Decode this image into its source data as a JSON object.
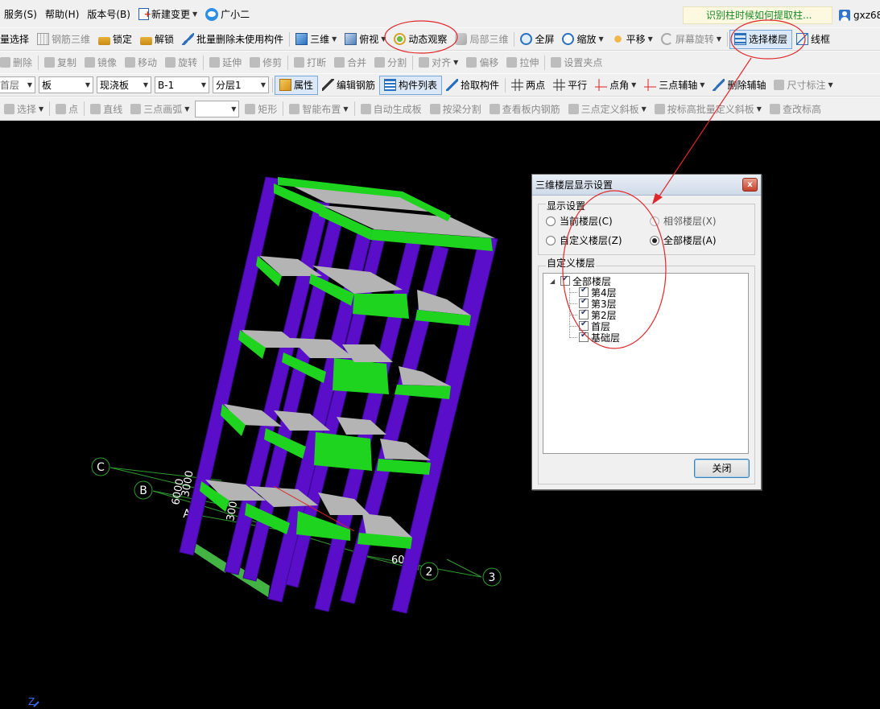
{
  "menubar": {
    "items": [
      {
        "label": "服务(S)"
      },
      {
        "label": "帮助(H)"
      },
      {
        "label": "版本号(B)"
      },
      {
        "label": "新建变更"
      },
      {
        "label": "广小二"
      }
    ],
    "hint": "识别柱时候如何提取柱...",
    "user": "gxz68"
  },
  "toolbar1": {
    "items": [
      "量选择",
      "钢筋三维",
      "锁定",
      "解锁",
      "批量删除未使用构件",
      "三维",
      "俯视",
      "动态观察",
      "局部三维",
      "全屏",
      "缩放",
      "平移",
      "屏幕旋转",
      "选择楼层",
      "线框"
    ]
  },
  "toolbar2": {
    "items": [
      "删除",
      "复制",
      "镜像",
      "移动",
      "旋转",
      "延伸",
      "修剪",
      "打断",
      "合并",
      "分割",
      "对齐",
      "偏移",
      "拉伸",
      "设置夹点"
    ]
  },
  "toolbar3": {
    "floor": "首层",
    "component_type": "板",
    "subtype": "现浇板",
    "name": "B-1",
    "layer": "分层1",
    "items": [
      "属性",
      "编辑钢筋",
      "构件列表",
      "拾取构件",
      "两点",
      "平行",
      "点角",
      "三点辅轴",
      "删除辅轴",
      "尺寸标注"
    ]
  },
  "toolbar4": {
    "items": [
      "选择",
      "点",
      "直线",
      "三点画弧",
      "矩形",
      "智能布置",
      "自动生成板",
      "按梁分割",
      "查看板内钢筋",
      "三点定义斜板",
      "按标高批量定义斜板",
      "查改标高"
    ]
  },
  "viewport": {
    "axis_labels": [
      "C",
      "B",
      "A",
      "2",
      "3"
    ],
    "dimension_labels": [
      "6000",
      "3000",
      "3000",
      "6000"
    ],
    "z_axis": "Z"
  },
  "dialog": {
    "title": "三维楼层显示设置",
    "close_x": "x",
    "display_group": "显示设置",
    "radios": [
      {
        "label": "当前楼层(C)",
        "checked": false,
        "enabled": true
      },
      {
        "label": "相邻楼层(X)",
        "checked": false,
        "enabled": false
      },
      {
        "label": "自定义楼层(Z)",
        "checked": false,
        "enabled": true
      },
      {
        "label": "全部楼层(A)",
        "checked": true,
        "enabled": true
      }
    ],
    "custom_group": "自定义楼层",
    "tree": [
      {
        "label": "全部楼层",
        "checked": true,
        "level": 0
      },
      {
        "label": "第4层",
        "checked": true,
        "level": 1
      },
      {
        "label": "第3层",
        "checked": true,
        "level": 1
      },
      {
        "label": "第2层",
        "checked": true,
        "level": 1
      },
      {
        "label": "首层",
        "checked": true,
        "level": 1
      },
      {
        "label": "基础层",
        "checked": true,
        "level": 1
      }
    ],
    "close_button": "关闭"
  },
  "colors": {
    "columns": "#5a0ec9",
    "beams": "#1fd41f",
    "slabs": "#b4b4b4",
    "annotation": "#e0282c"
  }
}
